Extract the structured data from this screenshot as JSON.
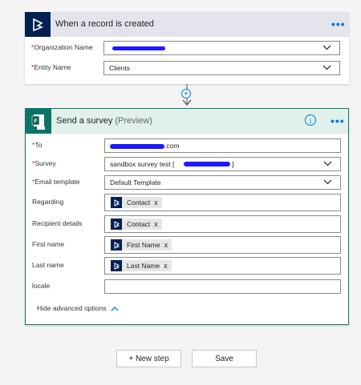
{
  "trigger": {
    "title": "When a record is created",
    "more_label": "•••",
    "fields": [
      {
        "label": "Organization Name",
        "required": true,
        "value": ""
      },
      {
        "label": "Entity Name",
        "required": true,
        "value": "Clients"
      }
    ]
  },
  "connector": {
    "add_icon": "+",
    "arrow_icon": "arrow-down"
  },
  "action": {
    "title": "Send a survey",
    "subtitle": "(Preview)",
    "info_label": "i",
    "more_label": "•••",
    "app_icon_text": "FRE",
    "fields": {
      "to": {
        "label": "To",
        "required": true,
        "value_suffix": ".com"
      },
      "survey": {
        "label": "Survey",
        "required": true,
        "value_prefix": "sandbox survey test [",
        "value_suffix": "]"
      },
      "email_template": {
        "label": "Email template",
        "required": true,
        "value": "Default Template"
      },
      "regarding": {
        "label": "Regarding",
        "required": false,
        "token": "Contact"
      },
      "recipient_details": {
        "label": "Recipient details",
        "required": false,
        "token": "Contact"
      },
      "first_name": {
        "label": "First name",
        "required": false,
        "token": "First Name"
      },
      "last_name": {
        "label": "Last name",
        "required": false,
        "token": "Last Name"
      },
      "locale": {
        "label": "locale",
        "required": false,
        "value": ""
      }
    },
    "hide_advanced_label": "Hide advanced options",
    "token_remove": "x"
  },
  "footer": {
    "new_step_label": "+ New step",
    "save_label": "Save"
  },
  "colors": {
    "accent": "#0078d4",
    "action_border": "#0f7b5f",
    "action_header": "#dff1ea",
    "dynamics_icon": "#002050",
    "forms_icon": "#077568",
    "redaction": "#1d19ff"
  }
}
